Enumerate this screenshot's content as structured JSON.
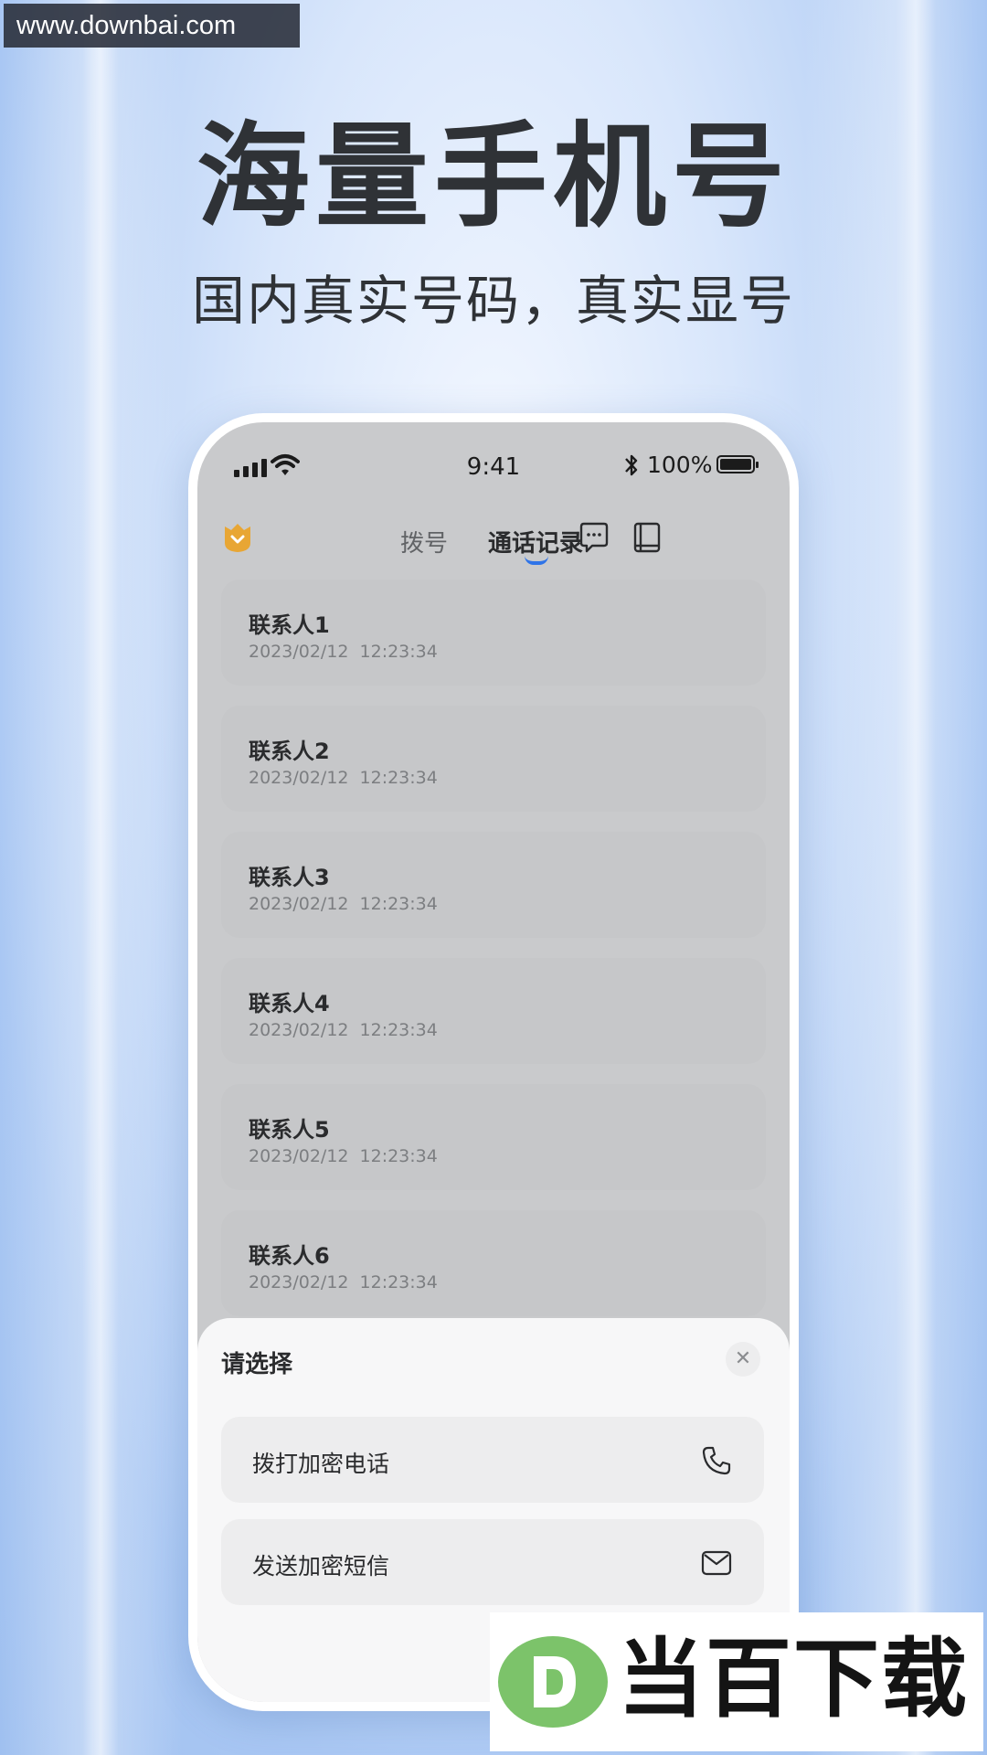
{
  "watermark": {
    "url": "www.downbai.com",
    "brand": "当百下载"
  },
  "headline": "海量手机号",
  "subline": "国内真实号码，真实显号",
  "status_bar": {
    "time": "9:41",
    "battery": "100%"
  },
  "nav": {
    "tabs": [
      {
        "label": "拨号",
        "active": false
      },
      {
        "label": "通话记录",
        "active": true
      }
    ],
    "icons": [
      "shield-badge-icon",
      "message-icon",
      "contacts-book-icon"
    ]
  },
  "call_log": [
    {
      "name": "联系人1",
      "date": "2023/02/12",
      "time": "12:23:34"
    },
    {
      "name": "联系人2",
      "date": "2023/02/12",
      "time": "12:23:34"
    },
    {
      "name": "联系人3",
      "date": "2023/02/12",
      "time": "12:23:34"
    },
    {
      "name": "联系人4",
      "date": "2023/02/12",
      "time": "12:23:34"
    },
    {
      "name": "联系人5",
      "date": "2023/02/12",
      "time": "12:23:34"
    },
    {
      "name": "联系人6",
      "date": "2023/02/12",
      "time": "12:23:34"
    }
  ],
  "sheet": {
    "title": "请选择",
    "options": [
      {
        "label": "拨打加密电话",
        "icon": "phone-icon"
      },
      {
        "label": "发送加密短信",
        "icon": "mail-icon"
      }
    ]
  },
  "colors": {
    "accent": "#2f74e8",
    "badge": "#e8a634",
    "logo_green": "#7cc36a"
  }
}
